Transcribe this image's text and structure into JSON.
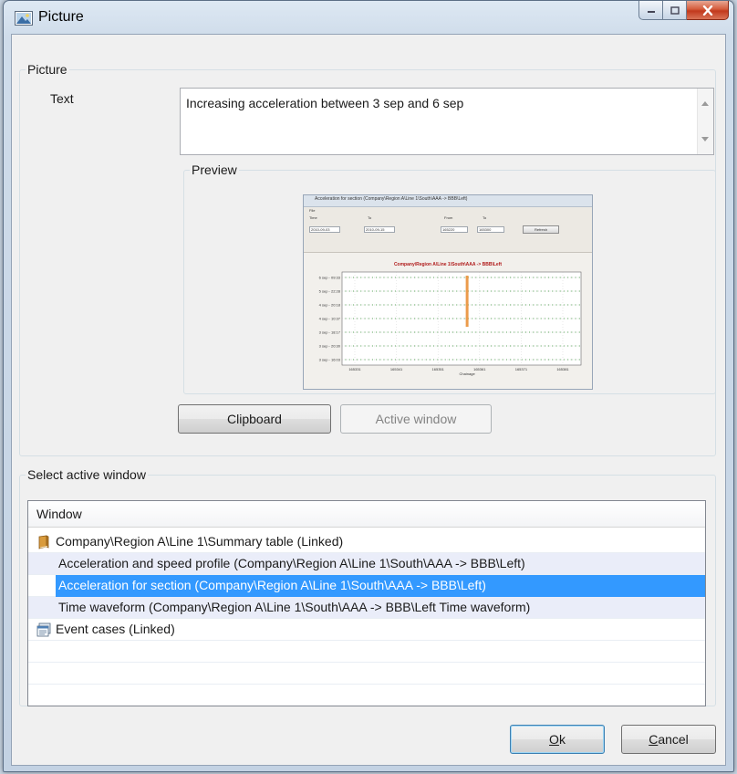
{
  "window": {
    "title": "Picture"
  },
  "picture_group": {
    "legend": "Picture",
    "text_label": "Text",
    "text_value": "Increasing acceleration between 3 sep and 6 sep",
    "preview_legend": "Preview"
  },
  "buttons": {
    "clipboard": "Clipboard",
    "active_window": "Active window",
    "ok_mnemonic": "O",
    "ok_rest": "k",
    "cancel_mnemonic": "C",
    "cancel_rest": "ancel"
  },
  "select_group": {
    "legend": "Select active window",
    "column_header": "Window",
    "rows": [
      {
        "label": "Company\\Region A\\Line 1\\Summary table (Linked)",
        "icon": "book-icon"
      },
      {
        "label": "Acceleration and speed profile (Company\\Region A\\Line 1\\South\\AAA -> BBB\\Left)"
      },
      {
        "label": "Acceleration for section (Company\\Region A\\Line 1\\South\\AAA -> BBB\\Left)",
        "selected": true
      },
      {
        "label": "Time waveform (Company\\Region A\\Line 1\\South\\AAA -> BBB\\Left Time waveform)"
      },
      {
        "label": "Event cases (Linked)",
        "icon": "event-list-icon"
      }
    ]
  },
  "preview_thumbnail": {
    "caption": "Acceleration for section (Company\\Region A\\Line 1\\South\\AAA -> BBB\\Left)",
    "menu": "File",
    "time_label": "Time",
    "from_label": "From",
    "to_label": "To",
    "from_date": "2010-09-03",
    "to_date": "2010-09-15",
    "from_ch": "165220",
    "to_ch": "165300",
    "refresh_label": "Refresh",
    "chart_title": "Company\\Region A\\Line 1\\South\\AAA -> BBB\\Left",
    "xlabel": "Chainage"
  },
  "chart_data": {
    "type": "scatter",
    "title": "Company\\Region A\\Line 1\\South\\AAA -> BBB\\Left",
    "xlabel": "Chainage",
    "ylabel": "",
    "x_ticks": [
      "165331",
      "165341",
      "165351",
      "165361",
      "165371",
      "165381"
    ],
    "y_ticks": [
      "6 sep - 09:33",
      "5 sep - 22:28",
      "4 sep - 20:18",
      "4 sep - 10:37",
      "3 sep - 18:17",
      "3 sep - 20:30",
      "3 sep - 16:03"
    ],
    "highlight_x": 165358,
    "grid": true,
    "colors": {
      "grid": "#b9b9b9",
      "points": "#2f8f2f",
      "highlight": "#e98a2c",
      "title": "#b01b1b"
    }
  }
}
